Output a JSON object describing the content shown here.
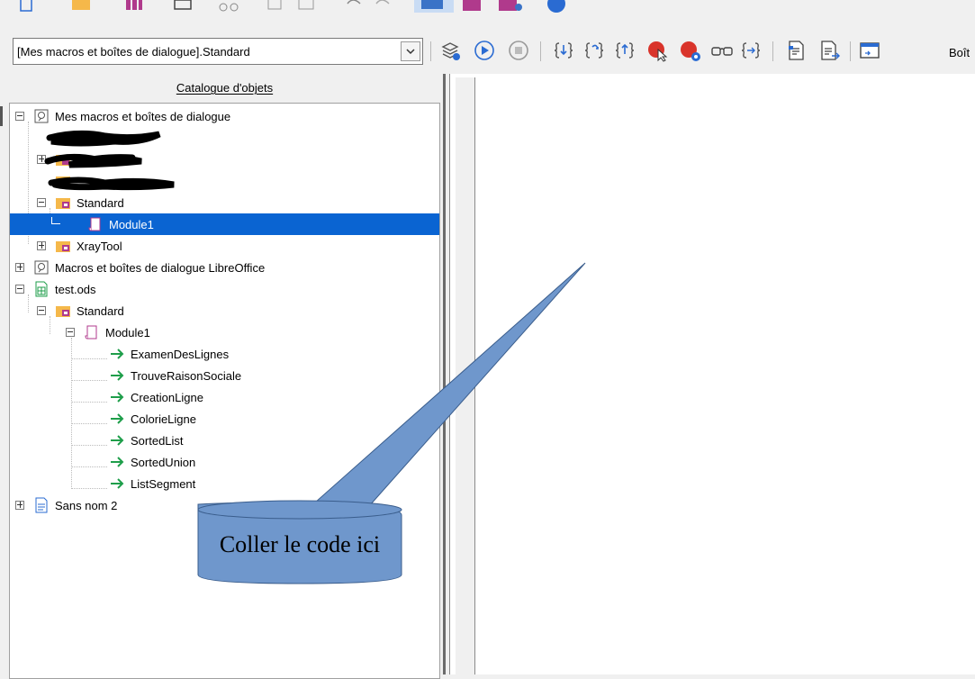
{
  "toolbar": {
    "library_value": "[Mes macros et boîtes de dialogue].Standard",
    "icons": [
      "select-module-icon",
      "run-icon",
      "stop-icon",
      "step-into-icon",
      "step-over-icon",
      "step-out-icon",
      "breakpoint-icon",
      "manage-breakpoints-icon",
      "watch-icon",
      "find-parentheses-icon",
      "compile-icon",
      "export-icon",
      "insert-dialog-icon"
    ],
    "dialog_label": "Boît"
  },
  "catalog": {
    "title": "Catalogue d'objets",
    "tree": {
      "my_macros": "Mes macros et boîtes de dialogue",
      "standard_1": "Standard",
      "module1_selected": "Module1",
      "xraytool": "XrayTool",
      "libreoffice_macros": "Macros et boîtes de dialogue LibreOffice",
      "test_ods": "test.ods",
      "standard_2": "Standard",
      "module1": "Module1",
      "macros": [
        "ExamenDesLignes",
        "TrouveRaisonSociale",
        "CreationLigne",
        "ColorieLigne",
        "SortedList",
        "SortedUnion",
        "ListSegment"
      ],
      "sans_nom": "Sans nom 2"
    }
  },
  "annotation": {
    "callout_text": "Coller le code ici",
    "fill": "#6f97cc",
    "stroke": "#3a5d8c"
  },
  "colors": {
    "selection": "#0a64d2",
    "arrow_green": "#1e9e4a"
  }
}
